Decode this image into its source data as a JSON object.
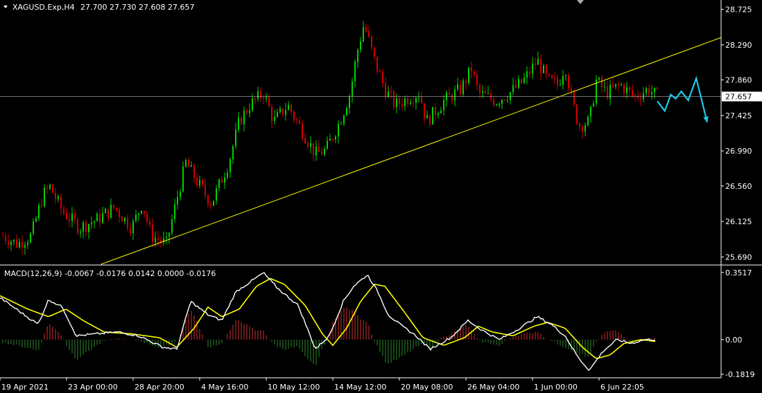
{
  "colors": {
    "background": "#000000",
    "bull": "#00d200",
    "bear": "#d20000",
    "trendline": "#ffff00",
    "arrow": "#1ec8e6",
    "macd_line": "#ffffff",
    "signal_line": "#ffff00",
    "hist_pos": "#d23232",
    "hist_neg": "#2e8b2e",
    "axis": "#ffffff"
  },
  "header": {
    "symbol": "XAGUSD.Exp,H4",
    "ohlc": "27.700 27.730 27.608 27.657"
  },
  "chart_data": [
    {
      "type": "candlestick",
      "price_axis": [
        "28.725",
        "28.290",
        "27.860",
        "27.425",
        "26.990",
        "26.560",
        "26.125",
        "25.690"
      ],
      "current_price": "27.657",
      "ylim": [
        25.6,
        28.84
      ],
      "trendline": {
        "start": [
          0.14,
          25.6
        ],
        "end": [
          1.0,
          28.38
        ]
      },
      "projection_arrow": [
        [
          0,
          27.6
        ],
        [
          0.15,
          27.48
        ],
        [
          0.27,
          27.68
        ],
        [
          0.37,
          27.63
        ],
        [
          0.48,
          27.72
        ],
        [
          0.62,
          27.61
        ],
        [
          0.78,
          27.88
        ],
        [
          1.0,
          27.34
        ]
      ],
      "bull_candle_color": "green",
      "bear_candle_color": "red"
    },
    {
      "type": "macd",
      "label": "MACD(12,26,9) -0.0067 -0.0176 0.0142 0.0000 -0.0176",
      "axis": [
        "0.3517",
        "0.00",
        "-0.1819"
      ],
      "ylim": [
        -0.2,
        0.38
      ]
    }
  ],
  "time_axis": [
    "19 Apr 2021",
    "23 Apr 00:00",
    "28 Apr 20:00",
    "4 May 16:00",
    "10 May 12:00",
    "14 May 12:00",
    "20 May 08:00",
    "26 May 04:00",
    "1 Jun 00:00",
    "6 Jun 22:05"
  ]
}
